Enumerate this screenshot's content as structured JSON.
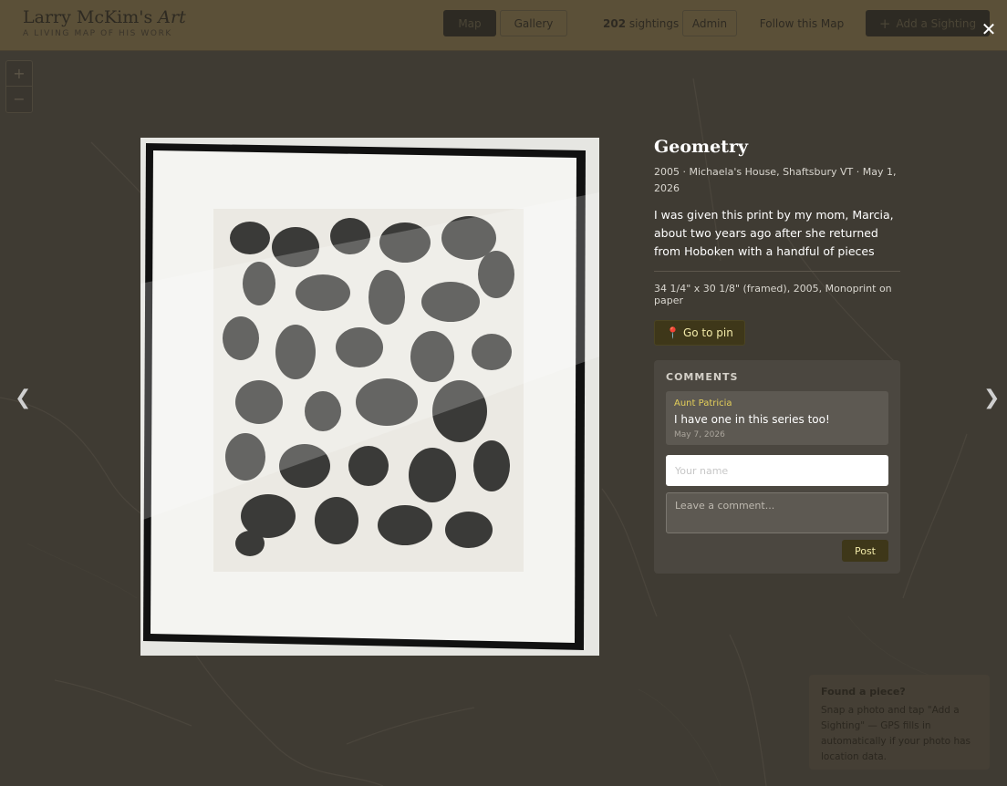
{
  "header": {
    "title_plain": "Larry McKim's ",
    "title_italic": "Art",
    "subtitle": "A LIVING MAP OF HIS WORK",
    "nav_map": "Map",
    "nav_gallery": "Gallery",
    "sightings_count": "202",
    "sightings_label": "sightings",
    "admin": "Admin",
    "follow": "Follow this Map",
    "add_sighting": "Add a Sighting"
  },
  "close_label": "✕",
  "zoom": {
    "in": "+",
    "out": "−"
  },
  "nav_arrows": {
    "prev": "❮",
    "next": "❯"
  },
  "artwork": {
    "title": "Geometry",
    "meta": "2005 · Michaela's House, Shaftsbury VT · May 1, 2026",
    "description": "I was given this print by my mom, Marcia, about two years ago after she returned from Hoboken with a handful of pieces",
    "spec": "34 1/4\" x 30 1/8\" (framed), 2005, Monoprint on paper",
    "goto_pin": "Go to pin"
  },
  "comments": {
    "heading": "COMMENTS",
    "items": [
      {
        "author": "Aunt Patricia",
        "text": "I have one in this series too!",
        "date": "May 7, 2026"
      }
    ],
    "name_placeholder": "Your name",
    "comment_placeholder": "Leave a comment...",
    "post": "Post"
  },
  "tip": {
    "title": "Found a piece?",
    "body": "Snap a photo and tap \"Add a Sighting\" — GPS fills in automatically if your photo has location data."
  },
  "colors": {
    "accent_gold": "#e4cf5a",
    "button_dark": "#3e3719",
    "overlay": "#3f3b33"
  }
}
